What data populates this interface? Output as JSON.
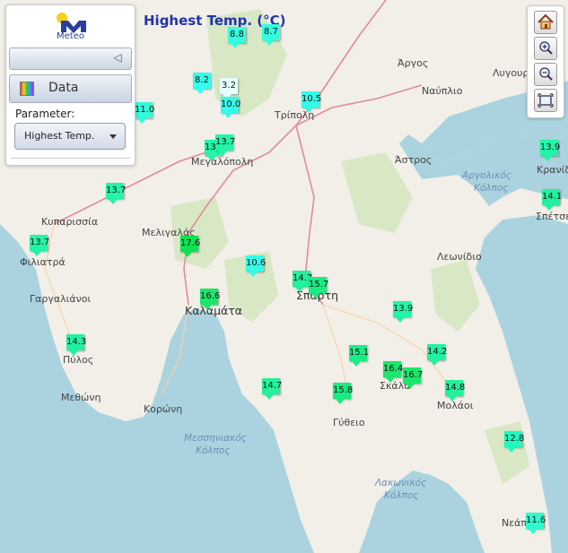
{
  "title": "Highest Temp. (°C)",
  "logo_text": "Meteo",
  "panel": {
    "data_button_label": "Data",
    "parameter_label": "Parameter:",
    "parameter_selected": "Highest Temp."
  },
  "controls": {
    "home": "home-icon",
    "zoom_in": "zoom-in-icon",
    "zoom_out": "zoom-out-icon",
    "extent": "fit-extent-icon"
  },
  "places": [
    {
      "name": "Τρίπολη",
      "kind": "town"
    },
    {
      "name": "Άργος",
      "kind": "town"
    },
    {
      "name": "Λυγουριό",
      "kind": "town"
    },
    {
      "name": "Ναύπλιο",
      "kind": "town"
    },
    {
      "name": "Μεγαλόπολη",
      "kind": "town"
    },
    {
      "name": "Άστρος",
      "kind": "town"
    },
    {
      "name": "Αργολικός",
      "kind": "sea"
    },
    {
      "name": "Κόλπος",
      "kind": "sea"
    },
    {
      "name": "Κρανίδι",
      "kind": "town"
    },
    {
      "name": "Σπέτσες",
      "kind": "town"
    },
    {
      "name": "Κυπαρισσία",
      "kind": "town"
    },
    {
      "name": "Μελιγαλάς",
      "kind": "town"
    },
    {
      "name": "Φιλιατρά",
      "kind": "town"
    },
    {
      "name": "Λεωνίδιο",
      "kind": "town"
    },
    {
      "name": "Γαργαλιάνοι",
      "kind": "town"
    },
    {
      "name": "Καλαμάτα",
      "kind": "city"
    },
    {
      "name": "Σπάρτη",
      "kind": "city"
    },
    {
      "name": "Πύλος",
      "kind": "town"
    },
    {
      "name": "Σκάλα",
      "kind": "town"
    },
    {
      "name": "Μολάοι",
      "kind": "town"
    },
    {
      "name": "Μεθώνη",
      "kind": "town"
    },
    {
      "name": "Κορώνη",
      "kind": "town"
    },
    {
      "name": "Γύθειο",
      "kind": "town"
    },
    {
      "name": "Μεσσηνιακός",
      "kind": "sea"
    },
    {
      "name": "Κόλπος",
      "kind": "sea"
    },
    {
      "name": "Λακωνικός",
      "kind": "sea"
    },
    {
      "name": "Κόλπος",
      "kind": "sea"
    },
    {
      "name": "Νεάπολη",
      "kind": "town"
    }
  ],
  "stations": [
    {
      "value": "8.8",
      "color": "#33ffe0"
    },
    {
      "value": "8.7",
      "color": "#33ffe0"
    },
    {
      "value": "8.2",
      "color": "#33ffee"
    },
    {
      "value": "3.2",
      "color": "#e6ffff"
    },
    {
      "value": "10.0",
      "color": "#33fbe8"
    },
    {
      "value": "11.0",
      "color": "#33fbd8"
    },
    {
      "value": "10.5",
      "color": "#33fbe6"
    },
    {
      "value": "13.8",
      "color": "#22f5a8"
    },
    {
      "value": "13.7",
      "color": "#22f5a8"
    },
    {
      "value": "13.9",
      "color": "#22f5a8"
    },
    {
      "value": "13.7",
      "color": "#22f5a8"
    },
    {
      "value": "14.1",
      "color": "#22f2a0"
    },
    {
      "value": "13.7",
      "color": "#22f5a8"
    },
    {
      "value": "17.6",
      "color": "#11e055"
    },
    {
      "value": "10.6",
      "color": "#33fbe6"
    },
    {
      "value": "14.7",
      "color": "#22f09a"
    },
    {
      "value": "15.7",
      "color": "#1aeb80"
    },
    {
      "value": "16.6",
      "color": "#1ae66a"
    },
    {
      "value": "13.9",
      "color": "#22f5a8"
    },
    {
      "value": "14.3",
      "color": "#22f2a0"
    },
    {
      "value": "15.1",
      "color": "#1aed88"
    },
    {
      "value": "14.2",
      "color": "#22f2a0"
    },
    {
      "value": "16.4",
      "color": "#1ae66e"
    },
    {
      "value": "16.7",
      "color": "#1ae66a"
    },
    {
      "value": "14.7",
      "color": "#22f09a"
    },
    {
      "value": "15.8",
      "color": "#1aeb80"
    },
    {
      "value": "14.8",
      "color": "#22f09a"
    },
    {
      "value": "12.8",
      "color": "#22f8c0"
    },
    {
      "value": "11.6",
      "color": "#2afcd0"
    }
  ]
}
